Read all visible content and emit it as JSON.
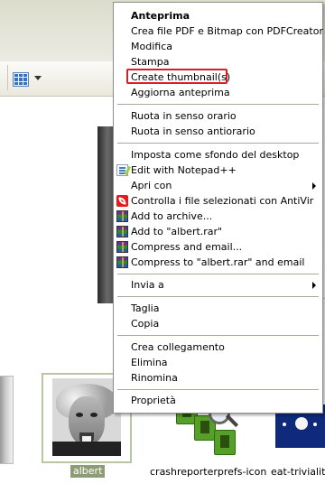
{
  "context_menu": {
    "items": [
      {
        "label": "Anteprima"
      },
      {
        "label": "Crea file PDF e Bitmap con PDFCreator"
      },
      {
        "label": "Modifica"
      },
      {
        "label": "Stampa"
      },
      {
        "label": "Create thumbnail(s)"
      },
      {
        "label": "Aggiorna anteprima"
      },
      {
        "label": "Ruota in senso orario"
      },
      {
        "label": "Ruota in senso antiorario"
      },
      {
        "label": "Imposta come sfondo del desktop"
      },
      {
        "label": "Edit with Notepad++",
        "icon": "notepad-plus-plus-icon"
      },
      {
        "label": "Apri con"
      },
      {
        "label": "Controlla i file selezionati con AntiVir",
        "icon": "antivir-icon"
      },
      {
        "label": "Add to archive...",
        "icon": "winrar-icon"
      },
      {
        "label": "Add to \"albert.rar\"",
        "icon": "winrar-icon"
      },
      {
        "label": "Compress and email...",
        "icon": "winrar-icon"
      },
      {
        "label": "Compress to \"albert.rar\" and email",
        "icon": "winrar-icon"
      },
      {
        "label": "Invia a"
      },
      {
        "label": "Taglia"
      },
      {
        "label": "Copia"
      },
      {
        "label": "Crea collegamento"
      },
      {
        "label": "Elimina"
      },
      {
        "label": "Rinomina"
      },
      {
        "label": "Proprietà"
      }
    ],
    "highlight_color": "#d81f26"
  },
  "files": [
    {
      "name": "albert"
    },
    {
      "name": "crashreporterprefs-icon"
    },
    {
      "name": "eat-triviality-"
    }
  ],
  "colors": {
    "selection_label_bg": "#8c9c74",
    "menu_border": "#8f8f8f",
    "separator": "#aca899"
  }
}
